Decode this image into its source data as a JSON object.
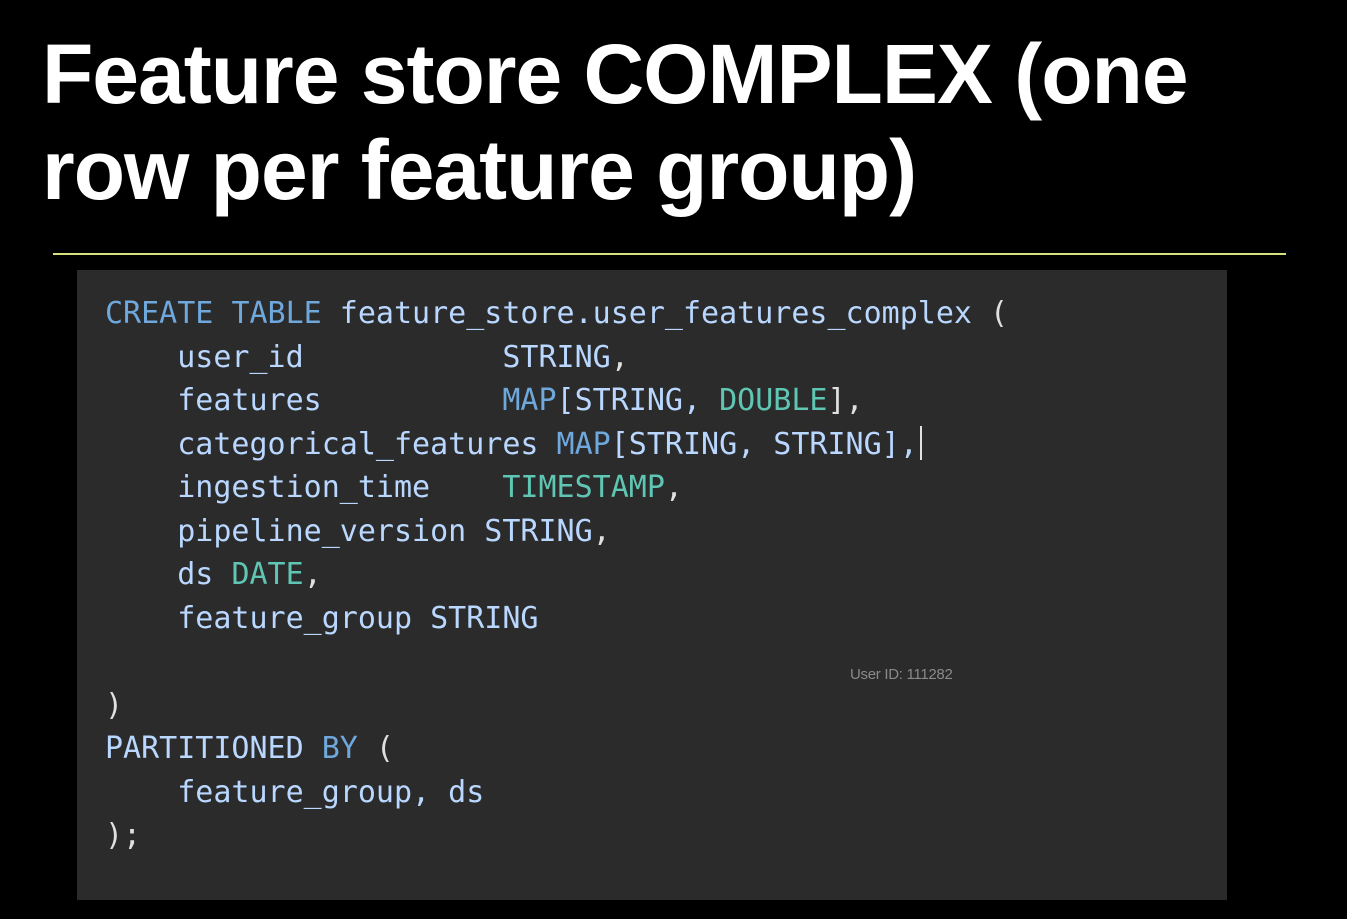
{
  "slide": {
    "title_line1": "Feature store COMPLEX (one",
    "title_line2": "row per feature group)"
  },
  "code": {
    "lines": [
      {
        "tokens": [
          {
            "t": "CREATE",
            "k": "kw"
          },
          {
            "t": " ",
            "k": "punc"
          },
          {
            "t": "TABLE",
            "k": "kw"
          },
          {
            "t": " feature_store.user_features_complex ",
            "k": "id"
          },
          {
            "t": "(",
            "k": "punc"
          }
        ]
      },
      {
        "tokens": [
          {
            "t": "    user_id           ",
            "k": "id"
          },
          {
            "t": "STRING",
            "k": "id"
          },
          {
            "t": ",",
            "k": "punc"
          }
        ]
      },
      {
        "tokens": [
          {
            "t": "    features          ",
            "k": "id"
          },
          {
            "t": "MAP",
            "k": "kw"
          },
          {
            "t": "[STRING, ",
            "k": "id"
          },
          {
            "t": "DOUBLE",
            "k": "ty"
          },
          {
            "t": "],",
            "k": "punc"
          }
        ]
      },
      {
        "tokens": [
          {
            "t": "    categorical_features ",
            "k": "id"
          },
          {
            "t": "MAP",
            "k": "kw"
          },
          {
            "t": "[STRING, STRING],",
            "k": "id"
          }
        ],
        "cursor": true
      },
      {
        "tokens": [
          {
            "t": "    ingestion_time    ",
            "k": "id"
          },
          {
            "t": "TIMESTAMP",
            "k": "ty"
          },
          {
            "t": ",",
            "k": "punc"
          }
        ]
      },
      {
        "tokens": [
          {
            "t": "    pipeline_version ",
            "k": "id"
          },
          {
            "t": "STRING",
            "k": "id"
          },
          {
            "t": ",",
            "k": "punc"
          }
        ]
      },
      {
        "tokens": [
          {
            "t": "    ds ",
            "k": "id"
          },
          {
            "t": "DATE",
            "k": "ty"
          },
          {
            "t": ",",
            "k": "punc"
          }
        ]
      },
      {
        "tokens": [
          {
            "t": "    feature_group STRING",
            "k": "id"
          }
        ]
      },
      {
        "tokens": [
          {
            "t": "",
            "k": "punc"
          }
        ]
      },
      {
        "tokens": [
          {
            "t": ")",
            "k": "punc"
          }
        ]
      },
      {
        "tokens": [
          {
            "t": "PARTITIONED",
            "k": "id"
          },
          {
            "t": " ",
            "k": "punc"
          },
          {
            "t": "BY",
            "k": "kw"
          },
          {
            "t": " (",
            "k": "punc"
          }
        ]
      },
      {
        "tokens": [
          {
            "t": "    feature_group, ds",
            "k": "id"
          }
        ]
      },
      {
        "tokens": [
          {
            "t": ");",
            "k": "punc"
          }
        ]
      }
    ]
  },
  "watermark": "User ID: 111282",
  "colors": {
    "background": "#000000",
    "panel": "#2b2b2b",
    "divider": "#d8e07c",
    "keyword": "#6fa8dc",
    "type": "#5fc6b4",
    "identifier": "#b9d7ff"
  }
}
